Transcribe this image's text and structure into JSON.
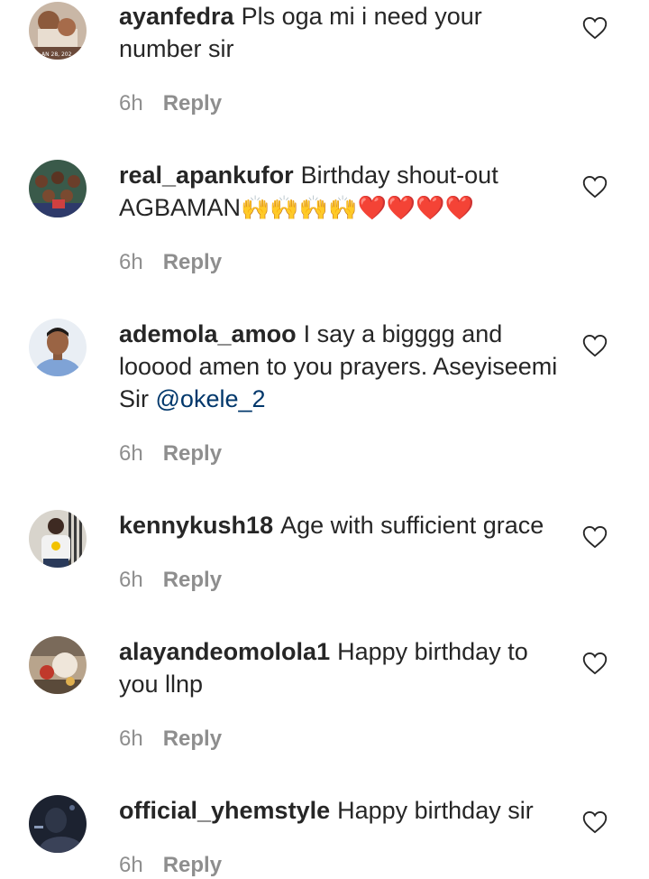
{
  "comments": [
    {
      "username": "ayanfedra",
      "text": "Pls oga mi i need your number sir",
      "time": "6h",
      "reply_label": "Reply",
      "avatar_caption": "AN 28, 202"
    },
    {
      "username": "real_apankufor",
      "text": "Birthday shout-out AGBAMAN",
      "emojis_raise": "🙌🙌🙌🙌",
      "emojis_heart": "❤️❤️❤️❤️",
      "time": "6h",
      "reply_label": "Reply"
    },
    {
      "username": "ademola_amoo",
      "text": "I say a bigggg and looood amen to you prayers. Aseyiseemi Sir",
      "mention": "@okele_2",
      "time": "6h",
      "reply_label": "Reply"
    },
    {
      "username": "kennykush18",
      "text": "Age with sufficient grace",
      "time": "6h",
      "reply_label": "Reply"
    },
    {
      "username": "alayandeomolola1",
      "text": "Happy birthday to you llnp",
      "time": "6h",
      "reply_label": "Reply"
    },
    {
      "username": "official_yhemstyle",
      "text": "Happy birthday sir",
      "time": "6h",
      "reply_label": "Reply"
    }
  ],
  "icons": {
    "like": "heart-outline-icon"
  },
  "colors": {
    "text": "#262626",
    "meta": "#8e8e8e",
    "mention": "#00376b"
  }
}
